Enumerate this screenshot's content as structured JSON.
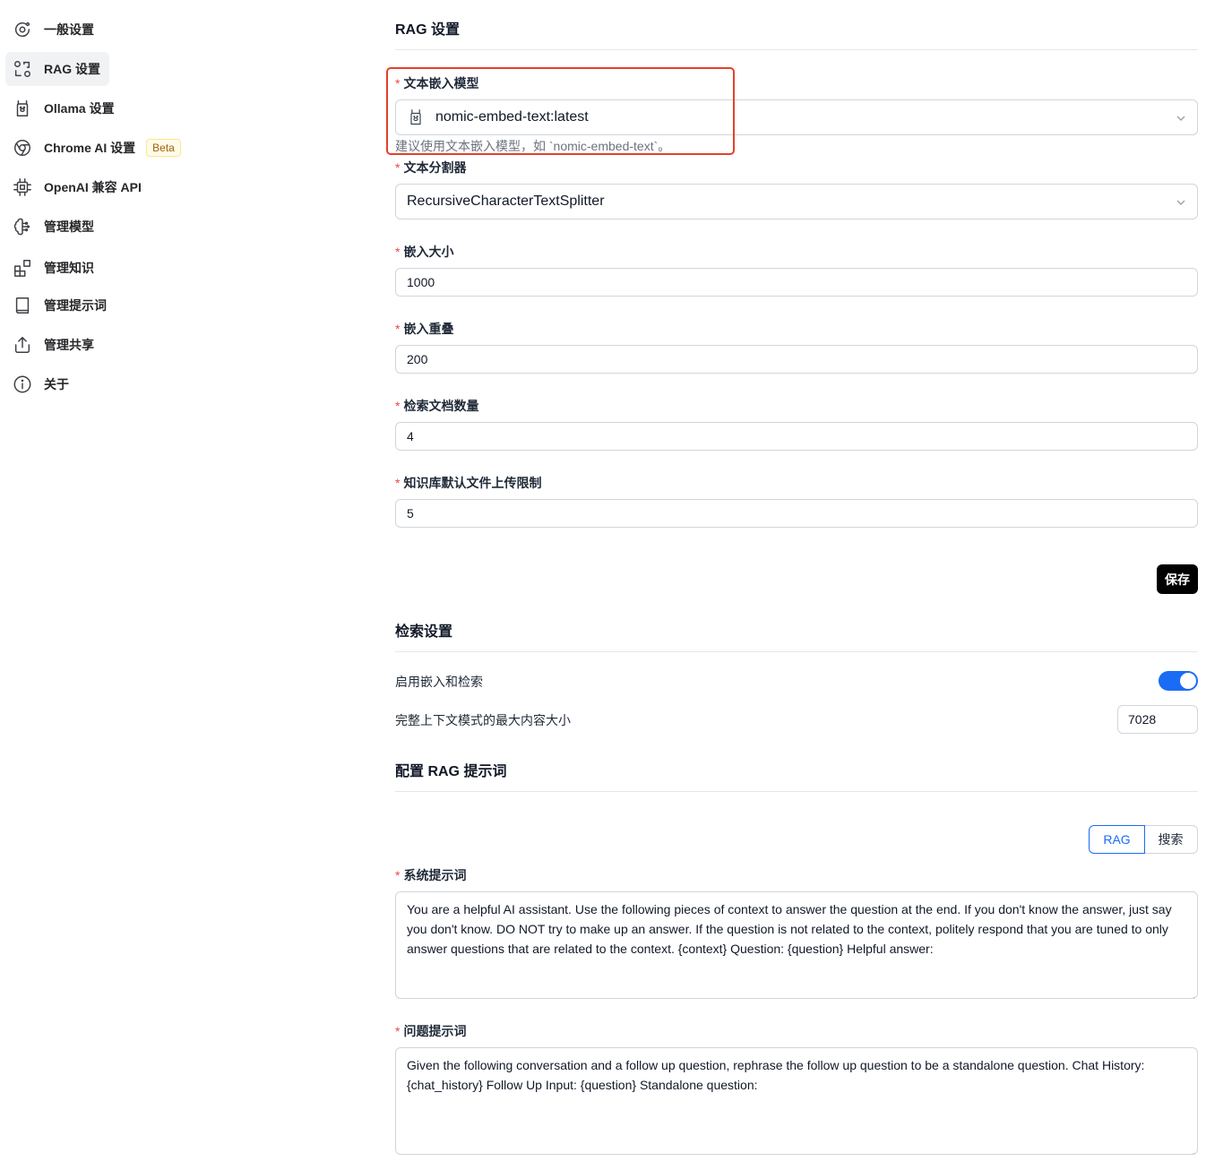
{
  "sidebar": {
    "items": [
      {
        "label": "一般设置",
        "icon": "orbit-settings-icon"
      },
      {
        "label": "RAG 设置",
        "icon": "rag-icon",
        "active": true
      },
      {
        "label": "Ollama 设置",
        "icon": "ollama-llama-icon"
      },
      {
        "label": "Chrome AI 设置",
        "icon": "chrome-icon",
        "badge": "Beta"
      },
      {
        "label": "OpenAI 兼容 API",
        "icon": "cpu-chip-icon"
      },
      {
        "label": "管理模型",
        "icon": "brain-icon"
      },
      {
        "label": "管理知识",
        "icon": "blocks-icon"
      },
      {
        "label": "管理提示词",
        "icon": "book-icon"
      },
      {
        "label": "管理共享",
        "icon": "share-icon"
      },
      {
        "label": "关于",
        "icon": "info-icon"
      }
    ]
  },
  "rag_settings": {
    "title": "RAG 设置",
    "embedding_model": {
      "label": "文本嵌入模型",
      "value": "nomic-embed-text:latest",
      "help": "建议使用文本嵌入模型，如 `nomic-embed-text`。"
    },
    "splitter": {
      "label": "文本分割器",
      "value": "RecursiveCharacterTextSplitter"
    },
    "chunk_size": {
      "label": "嵌入大小",
      "value": "1000"
    },
    "chunk_overlap": {
      "label": "嵌入重叠",
      "value": "200"
    },
    "num_docs": {
      "label": "检索文档数量",
      "value": "4"
    },
    "upload_limit": {
      "label": "知识库默认文件上传限制",
      "value": "5"
    },
    "required_mark": "*",
    "save_label": "保存"
  },
  "retrieval_settings": {
    "title": "检索设置",
    "enable_label": "启用嵌入和检索",
    "enabled": true,
    "max_context_label": "完整上下文模式的最大内容大小",
    "max_context_value": "7028"
  },
  "rag_prompt": {
    "title": "配置 RAG 提示词",
    "tabs": [
      "RAG",
      "搜索"
    ],
    "active_tab": "RAG",
    "system_prompt_label": "系统提示词",
    "system_prompt": "You are a helpful AI assistant. Use the following pieces of context to answer the question at the end. If you don't know the answer, just say you don't know. DO NOT try to make up an answer. If the question is not related to the context, politely respond that you are tuned to only answer questions that are related to the context.  {context}  Question: {question} Helpful answer:",
    "question_prompt_label": "问题提示词",
    "question_prompt": "Given the following conversation and a follow up question, rephrase the follow up question to be a standalone question.   Chat History: {chat_history} Follow Up Input: {question} Standalone question:"
  },
  "colors": {
    "accent": "#1a6cf5",
    "highlight_box": "#e5402a",
    "required": "#ef4444"
  }
}
